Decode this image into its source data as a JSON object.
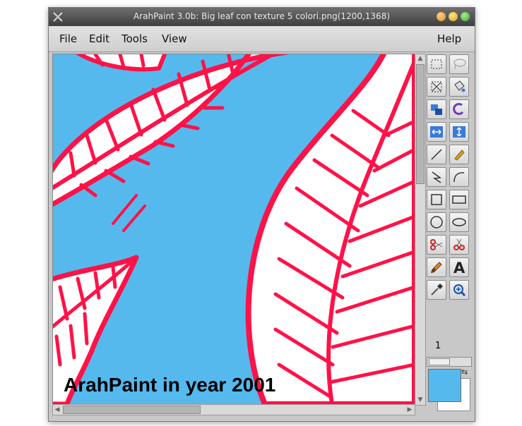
{
  "window": {
    "title": "ArahPaint 3.0b: Big leaf con texture 5 colori.png(1200,1368)",
    "buttons": {
      "minimize_color": "#f2a23a",
      "maximize_color": "#e6b935",
      "close_color": "#5fc75a"
    }
  },
  "menubar": {
    "items": [
      "File",
      "Edit",
      "Tools",
      "View"
    ],
    "help": "Help"
  },
  "canvas": {
    "background_color": "#55b9ee",
    "leaf_fill": "#ffffff",
    "vein_color": "#ff1248"
  },
  "toolbox": {
    "tools": [
      {
        "icon": "rect-select-icon"
      },
      {
        "icon": "lasso-select-icon"
      },
      {
        "icon": "crop-icon"
      },
      {
        "icon": "paint-bucket-icon"
      },
      {
        "icon": "transform-icon"
      },
      {
        "icon": "rotate-icon"
      },
      {
        "icon": "flip-horizontal-icon"
      },
      {
        "icon": "flip-vertical-icon"
      },
      {
        "icon": "line-icon"
      },
      {
        "icon": "pencil-icon"
      },
      {
        "icon": "polyline-icon"
      },
      {
        "icon": "curve-icon"
      },
      {
        "icon": "square-icon"
      },
      {
        "icon": "rectangle-icon"
      },
      {
        "icon": "circle-icon"
      },
      {
        "icon": "ellipse-icon"
      },
      {
        "icon": "cut-scissors-icon"
      },
      {
        "icon": "copy-scissors-icon"
      },
      {
        "icon": "brush-icon"
      },
      {
        "icon": "text-icon"
      },
      {
        "icon": "eyedropper-icon"
      },
      {
        "icon": "zoom-icon"
      }
    ],
    "brush_size": "1",
    "foreground_color": "#55b9ee",
    "background_color": "#ffffff"
  },
  "caption": "ArahPaint in year 2001"
}
